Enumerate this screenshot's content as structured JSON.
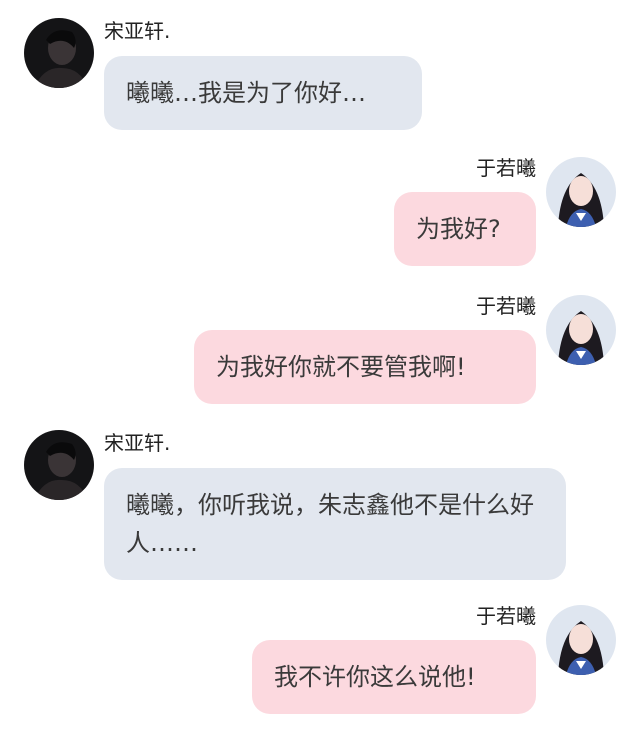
{
  "messages": [
    {
      "side": "left",
      "sender": "宋亚轩.",
      "avatar_icon": "male-avatar-icon",
      "text": "曦曦…我是为了你好…"
    },
    {
      "side": "right",
      "sender": "于若曦",
      "avatar_icon": "female-avatar-icon",
      "text": "为我好?"
    },
    {
      "side": "right",
      "sender": "于若曦",
      "avatar_icon": "female-avatar-icon",
      "text": "为我好你就不要管我啊!"
    },
    {
      "side": "left",
      "sender": "宋亚轩.",
      "avatar_icon": "male-avatar-icon",
      "text": "曦曦，你听我说，朱志鑫他不是什么好人……"
    },
    {
      "side": "right",
      "sender": "于若曦",
      "avatar_icon": "female-avatar-icon",
      "text": "我不许你这么说他!"
    }
  ],
  "colors": {
    "left_bubble": "#e2e7ef",
    "right_bubble": "#fcd9df",
    "background": "#ffffff"
  }
}
